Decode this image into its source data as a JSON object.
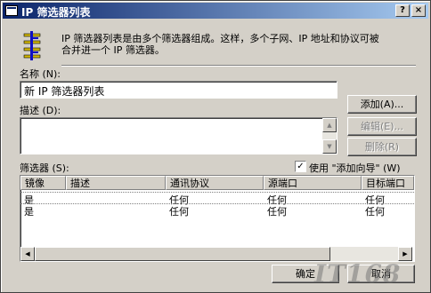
{
  "window": {
    "title": "IP 筛选器列表",
    "help_button": "?",
    "close_button": "×"
  },
  "intro": {
    "line1": "IP 筛选器列表是由多个筛选器组成。这样，多个子网、IP 地址和协议可被",
    "line2": "合并进一个 IP 筛选器。"
  },
  "name_field": {
    "label": "名称 (N):",
    "value": "新 IP 筛选器列表"
  },
  "description_field": {
    "label": "描述 (D):",
    "value": ""
  },
  "buttons": {
    "add": "添加(A)...",
    "edit": "编辑(E)...",
    "delete": "删除(R)",
    "ok": "确定",
    "cancel": "取消"
  },
  "filters": {
    "label": "筛选器 (S):",
    "wizard_checkbox": {
      "label": "使用 \"添加向导\" (W)",
      "checked": true
    },
    "columns": [
      "镜像",
      "描述",
      "通讯协议",
      "源端口",
      "目标端口"
    ],
    "rows": [
      [
        "是",
        "",
        "任何",
        "任何",
        "任何"
      ],
      [
        "是",
        "",
        "任何",
        "任何",
        "任何"
      ]
    ]
  },
  "watermark": "IT168"
}
